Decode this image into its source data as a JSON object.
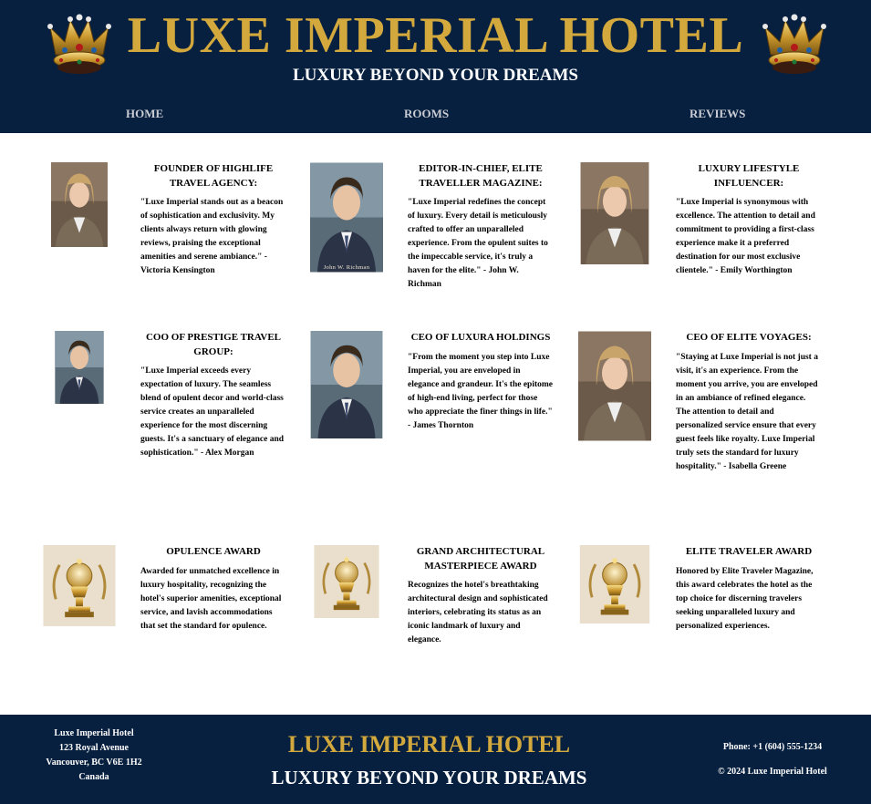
{
  "header": {
    "brand": "LUXE IMPERIAL HOTEL",
    "tagline": "LUXURY BEYOND YOUR DREAMS"
  },
  "nav": {
    "home": "HOME",
    "rooms": "ROOMS",
    "reviews": "REVIEWS"
  },
  "testimonials": [
    {
      "title": "FOUNDER OF HIGHLIFE TRAVEL AGENCY:",
      "text": "\"Luxe Imperial stands out as a beacon of sophistication and exclusivity. My clients always return with glowing reviews, praising the exceptional amenities and serene ambiance.\" - Victoria Kensington"
    },
    {
      "title": "EDITOR-IN-CHIEF, ELITE TRAVELLER MAGAZINE:",
      "text": "\"Luxe Imperial redefines the concept of luxury. Every detail is meticulously crafted to offer an unparalleled experience. From the opulent suites to the impeccable service, it's truly a haven for the elite.\" - John W. Richman",
      "photo_caption": "John W. Richman"
    },
    {
      "title": "LUXURY LIFESTYLE INFLUENCER:",
      "text": "\"Luxe Imperial is synonymous with excellence. The attention to detail and commitment to providing a first-class experience make it a preferred destination for our most exclusive clientele.\" - Emily Worthington"
    },
    {
      "title": "COO OF PRESTIGE TRAVEL GROUP:",
      "text": "\"Luxe Imperial exceeds every expectation of luxury. The seamless blend of opulent decor and world-class service creates an unparalleled experience for the most discerning guests. It's a sanctuary of elegance and sophistication.\" - Alex Morgan"
    },
    {
      "title": "CEO OF LUXURA HOLDINGS",
      "text": "\"From the moment you step into Luxe Imperial, you are enveloped in elegance and grandeur. It's the epitome of high-end living, perfect for those who appreciate the finer things in life.\" - James Thornton"
    },
    {
      "title": "CEO OF ELITE VOYAGES:",
      "text": "\"Staying at Luxe Imperial is not just a visit, it's an experience. From the moment you arrive, you are enveloped in an ambiance of refined elegance. The attention to detail and personalized service ensure that every guest feels like royalty. Luxe Imperial truly sets the standard for luxury hospitality.\" - Isabella Greene"
    }
  ],
  "awards": [
    {
      "title": "OPULENCE AWARD",
      "text": "Awarded for unmatched excellence in luxury hospitality, recognizing the hotel's superior amenities, exceptional service, and lavish accommodations that set the standard for opulence."
    },
    {
      "title": "GRAND ARCHITECTURAL MASTERPIECE AWARD",
      "text": "Recognizes the hotel's breathtaking architectural design and sophisticated interiors, celebrating its status as an iconic landmark of luxury and elegance."
    },
    {
      "title": "ELITE TRAVELER AWARD",
      "text": "Honored by Elite Traveler Magazine, this award celebrates the hotel as the top choice for discerning travelers seeking unparalleled luxury and personalized experiences."
    }
  ],
  "footer": {
    "address": [
      "Luxe Imperial Hotel",
      "123 Royal Avenue",
      "Vancouver, BC V6E 1H2",
      "Canada"
    ],
    "brand": "LUXE IMPERIAL HOTEL",
    "tagline": "LUXURY BEYOND YOUR DREAMS",
    "phone": "Phone: +1 (604) 555-1234",
    "copyright": "© 2024 Luxe Imperial Hotel"
  },
  "colors": {
    "navy": "#07203f",
    "gold": "#d3a93d"
  },
  "icons": [
    "crown-icon",
    "trophy-icon"
  ]
}
